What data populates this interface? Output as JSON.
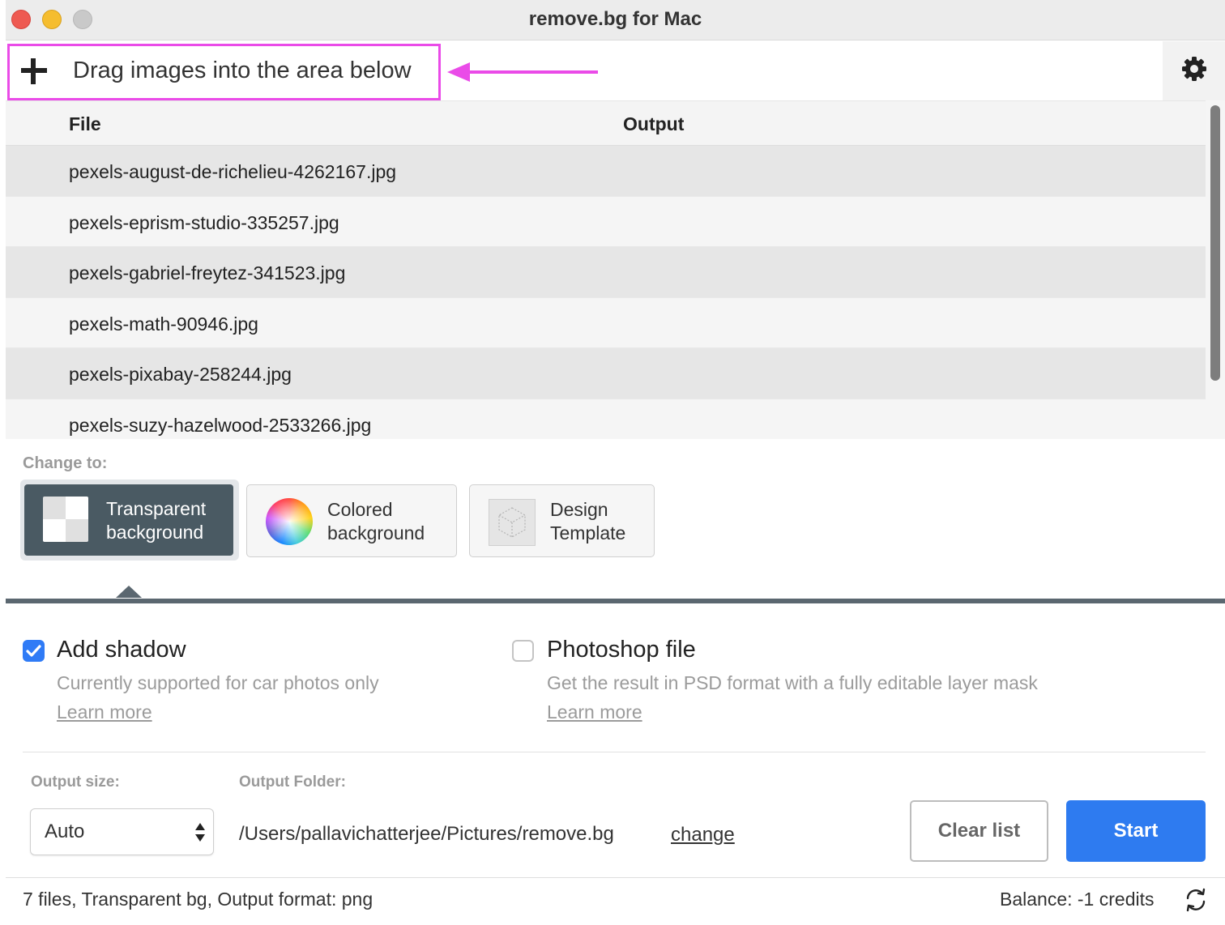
{
  "window": {
    "title": "remove.bg for Mac"
  },
  "toolbar": {
    "drag_text": "Drag images into the area below",
    "add_icon": "plus-icon",
    "settings_icon": "gear-icon",
    "highlight_color": "#ea4be8"
  },
  "table": {
    "columns": {
      "file": "File",
      "output": "Output"
    },
    "rows": [
      "pexels-august-de-richelieu-4262167.jpg",
      "pexels-eprism-studio-335257.jpg",
      "pexels-gabriel-freytez-341523.jpg",
      "pexels-math-90946.jpg",
      "pexels-pixabay-258244.jpg",
      "pexels-suzy-hazelwood-2533266.jpg"
    ]
  },
  "change_to": {
    "label": "Change to:",
    "options": [
      {
        "line1": "Transparent",
        "line2": "background",
        "icon": "checkerboard-icon",
        "selected": true
      },
      {
        "line1": "Colored",
        "line2": "background",
        "icon": "color-wheel-icon",
        "selected": false
      },
      {
        "line1": "Design",
        "line2": "Template",
        "icon": "cube-icon",
        "selected": false
      }
    ]
  },
  "options": {
    "shadow": {
      "checked": true,
      "title": "Add shadow",
      "description": "Currently supported for car photos only",
      "link": "Learn more"
    },
    "photoshop": {
      "checked": false,
      "title": "Photoshop file",
      "description": "Get the result in PSD format with a fully editable layer mask",
      "link": "Learn more"
    }
  },
  "output": {
    "size_label": "Output size:",
    "size_value": "Auto",
    "folder_label": "Output Folder:",
    "folder_path": "/Users/pallavichatterjee/Pictures/remove.bg",
    "folder_change": "change"
  },
  "buttons": {
    "clear": "Clear list",
    "start": "Start"
  },
  "status": {
    "summary": "7 files, Transparent bg, Output format: png",
    "balance": "Balance: -1 credits",
    "refresh_icon": "refresh-icon"
  },
  "colors": {
    "accent": "#2e7bf0",
    "selected_option": "#4a5a63"
  }
}
